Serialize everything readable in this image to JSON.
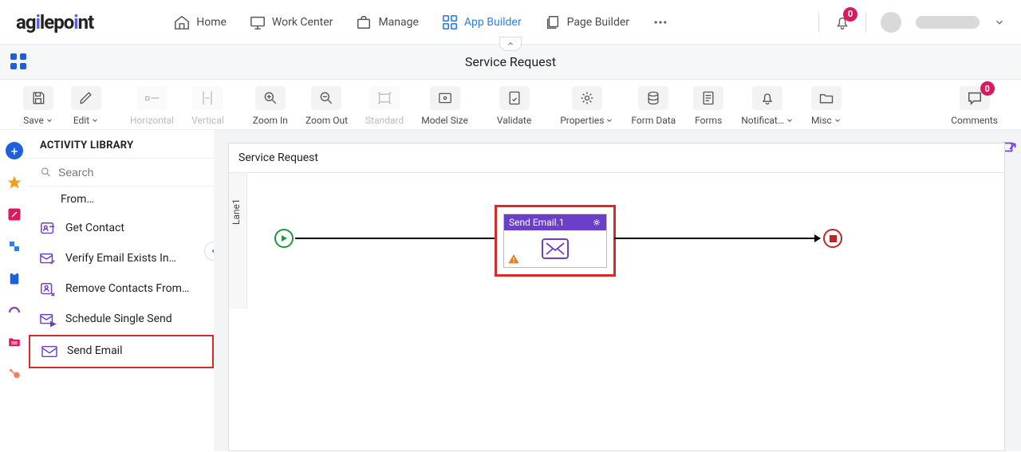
{
  "brand": "agilepoint",
  "nav": {
    "home": "Home",
    "work_center": "Work Center",
    "manage": "Manage",
    "app_builder": "App Builder",
    "page_builder": "Page Builder"
  },
  "notification_count": "0",
  "page_title": "Service Request",
  "toolbar": {
    "save": "Save",
    "edit": "Edit",
    "horizontal": "Horizontal",
    "vertical": "Vertical",
    "zoom_in": "Zoom In",
    "zoom_out": "Zoom Out",
    "standard": "Standard",
    "model_size": "Model Size",
    "validate": "Validate",
    "properties": "Properties",
    "form_data": "Form Data",
    "forms": "Forms",
    "notifications": "Notificat…",
    "misc": "Misc",
    "comments": "Comments",
    "comments_count": "0"
  },
  "library": {
    "title": "ACTIVITY LIBRARY",
    "search_placeholder": "Search",
    "items": [
      "From…",
      "Get Contact",
      "Verify Email Exists In…",
      "Remove Contacts From…",
      "Schedule Single Send",
      "Send Email"
    ]
  },
  "canvas": {
    "title": "Service Request",
    "lane_label": "Lane1",
    "activity_label": "Send Email.1"
  }
}
